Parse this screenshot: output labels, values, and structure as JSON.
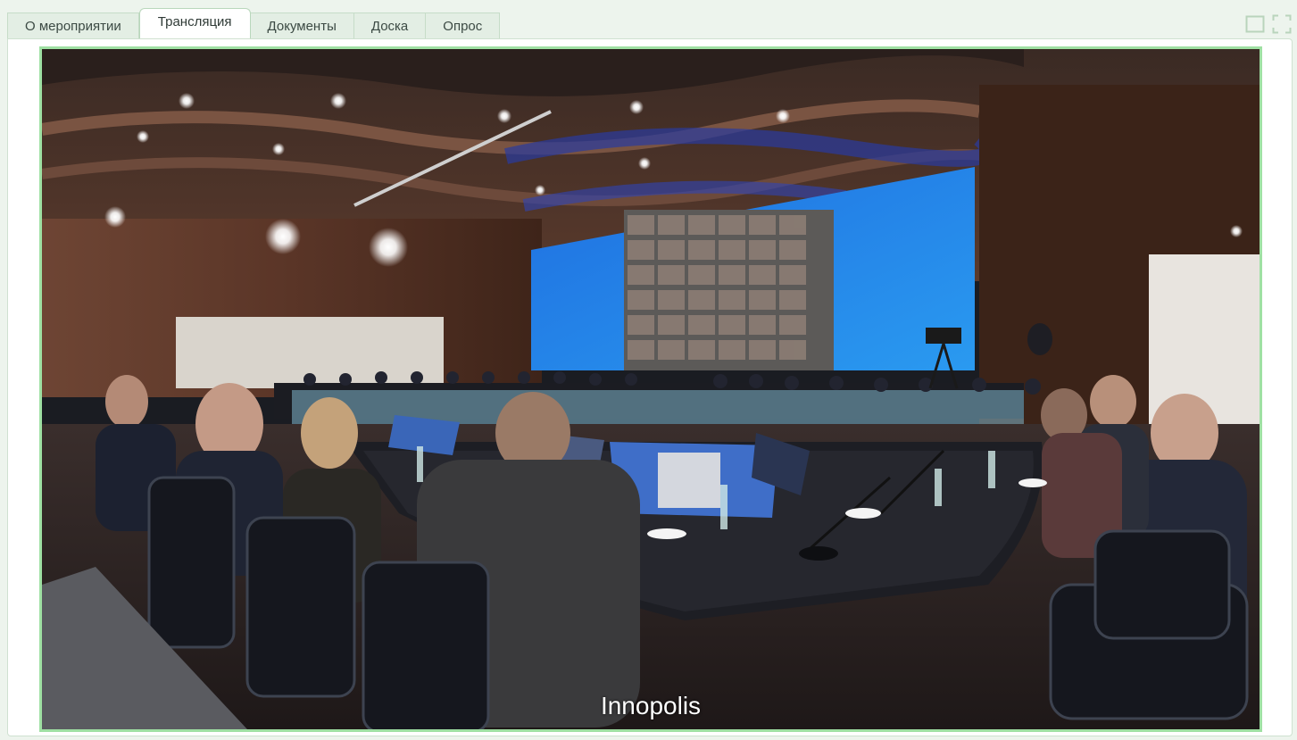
{
  "tabs": [
    {
      "label": "О мероприятии",
      "active": false
    },
    {
      "label": "Трансляция",
      "active": true
    },
    {
      "label": "Документы",
      "active": false
    },
    {
      "label": "Доска",
      "active": false
    },
    {
      "label": "Опрос",
      "active": false
    }
  ],
  "window_controls": {
    "restore_icon": "square-icon",
    "fullscreen_icon": "fullscreen-icon"
  },
  "video": {
    "caption": "Innopolis"
  },
  "colors": {
    "accent": "#9fe0a3",
    "tab_border": "#c6dcc8",
    "background": "#edf4ed"
  }
}
